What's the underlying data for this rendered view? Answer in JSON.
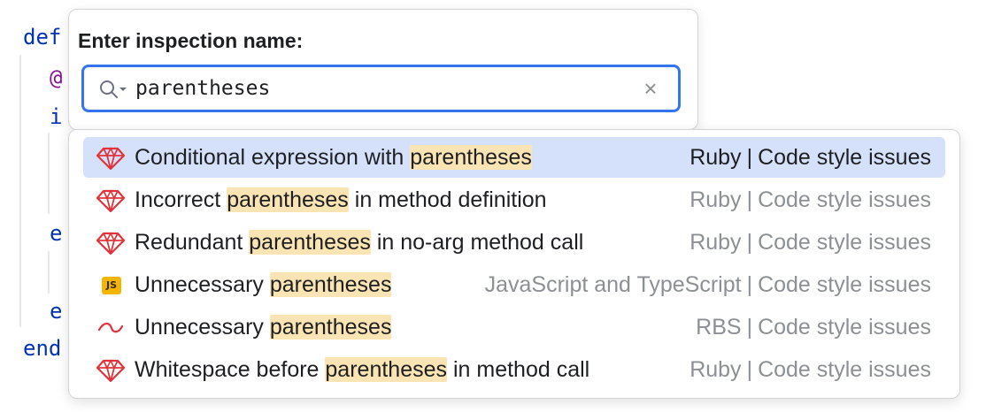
{
  "editor": {
    "lines": [
      "def",
      "@",
      "i",
      "e",
      "e",
      "end"
    ]
  },
  "popup": {
    "title": "Enter inspection name:",
    "search_value": "parentheses",
    "search_icon": "search-icon",
    "clear_icon": "clear-icon"
  },
  "results": [
    {
      "icon": "ruby-icon",
      "prefix": "Conditional expression with ",
      "match": "parentheses",
      "suffix": "",
      "language": "Ruby",
      "category": "Code style issues",
      "selected": true
    },
    {
      "icon": "ruby-icon",
      "prefix": "Incorrect ",
      "match": "parentheses",
      "suffix": " in method definition",
      "language": "Ruby",
      "category": "Code style issues",
      "selected": false
    },
    {
      "icon": "ruby-icon",
      "prefix": "Redundant ",
      "match": "parentheses",
      "suffix": " in no-arg method call",
      "language": "Ruby",
      "category": "Code style issues",
      "selected": false
    },
    {
      "icon": "javascript-icon",
      "badge": "JS",
      "prefix": "Unnecessary ",
      "match": "parentheses",
      "suffix": "",
      "language": "JavaScript and TypeScript",
      "category": "Code style issues",
      "selected": false
    },
    {
      "icon": "rbs-icon",
      "prefix": "Unnecessary ",
      "match": "parentheses",
      "suffix": "",
      "language": "RBS",
      "category": "Code style issues",
      "selected": false
    },
    {
      "icon": "ruby-icon",
      "prefix": "Whitespace before ",
      "match": "parentheses",
      "suffix": " in method call",
      "language": "Ruby",
      "category": "Code style issues",
      "selected": false
    }
  ],
  "separator": "|",
  "colors": {
    "accent": "#3574f0",
    "selection": "#d5e1fb",
    "match_highlight": "#fbe4b4",
    "ruby": "#e0343c",
    "javascript": "#f2b600"
  }
}
